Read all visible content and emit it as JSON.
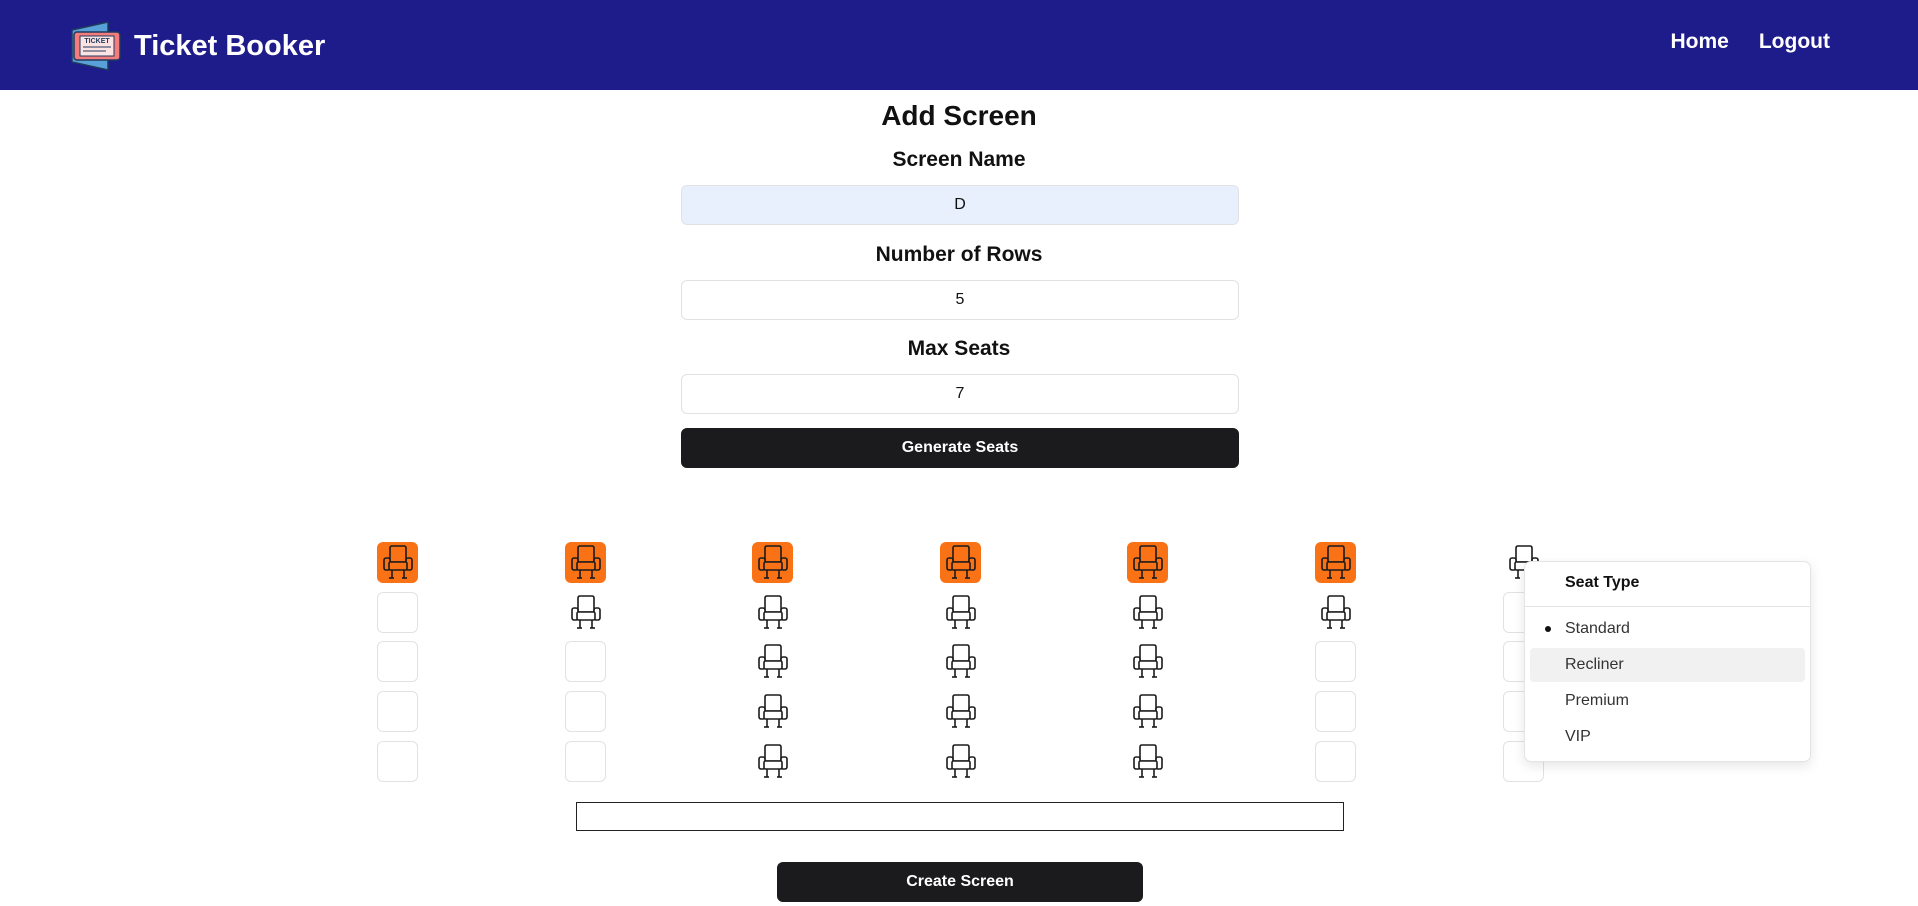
{
  "app": {
    "name": "Ticket Booker",
    "logo_icon": "ticket-icon",
    "logo_text": "TICKET"
  },
  "nav": {
    "home": "Home",
    "logout": "Logout"
  },
  "form": {
    "title": "Add Screen",
    "screen_name_label": "Screen Name",
    "screen_name_value": "D",
    "rows_label": "Number of Rows",
    "rows_value": "5",
    "max_seats_label": "Max Seats",
    "max_seats_value": "7",
    "generate_button": "Generate Seats",
    "create_button": "Create Screen"
  },
  "seat_grid": {
    "rows": [
      [
        "selected",
        "selected",
        "selected",
        "selected",
        "selected",
        "selected",
        "seat"
      ],
      [
        "empty",
        "seat",
        "seat",
        "seat",
        "seat",
        "seat",
        "empty"
      ],
      [
        "empty",
        "empty",
        "seat",
        "seat",
        "seat",
        "empty",
        "empty"
      ],
      [
        "empty",
        "empty",
        "seat",
        "seat",
        "seat",
        "empty",
        "empty"
      ],
      [
        "empty",
        "empty",
        "seat",
        "seat",
        "seat",
        "empty",
        "empty"
      ]
    ],
    "selected_color": "#f97316"
  },
  "seat_type_menu": {
    "title": "Seat Type",
    "options": [
      "Standard",
      "Recliner",
      "Premium",
      "VIP"
    ],
    "checked": "Standard",
    "highlighted": "Recliner"
  },
  "colors": {
    "navbar": "#1e1b8a",
    "button": "#1b1b1d",
    "accent": "#f97316"
  }
}
